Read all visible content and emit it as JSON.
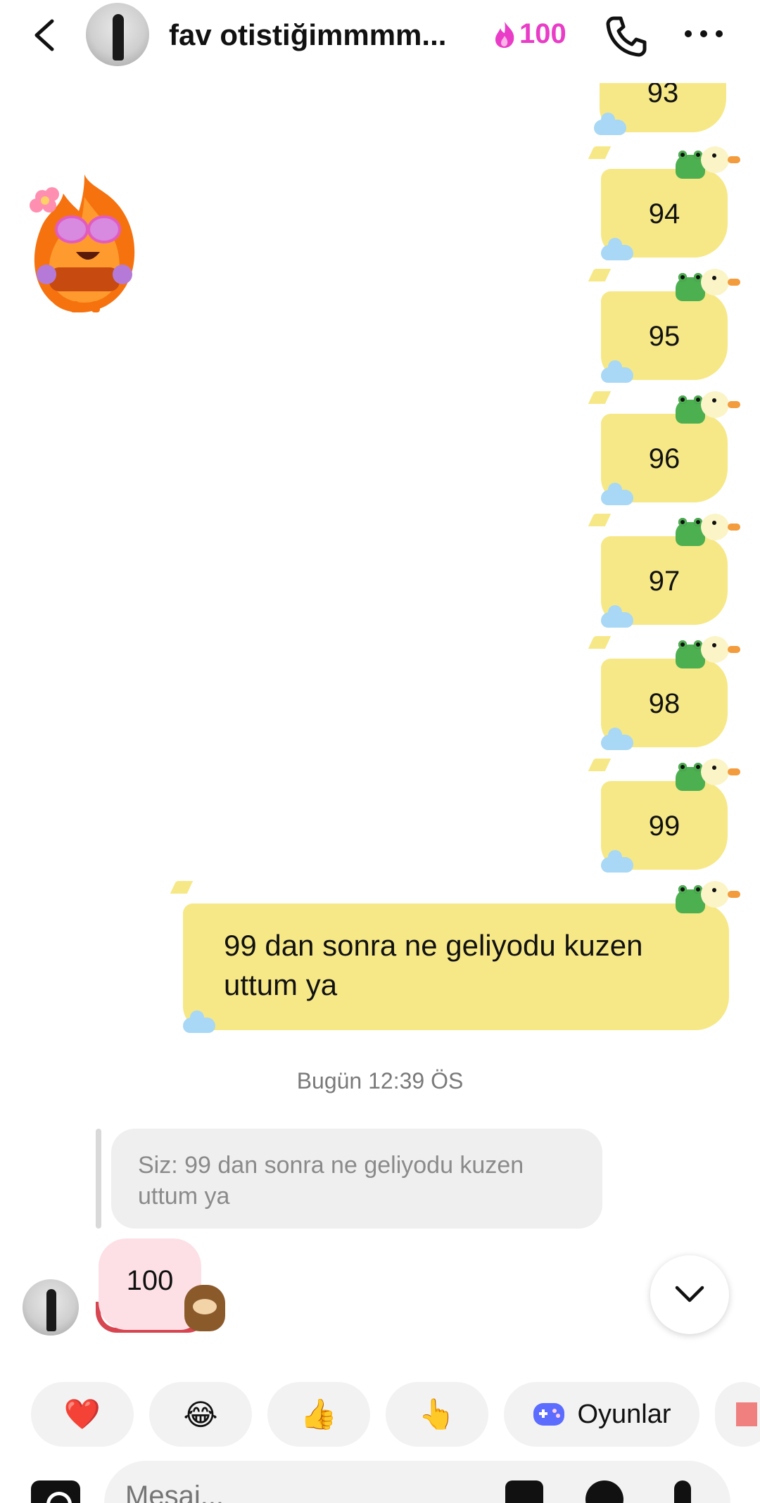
{
  "header": {
    "title": "fav otistiğimmmm...",
    "streak_count": "100",
    "icons": [
      "back-chevron-icon",
      "avatar",
      "fire-icon",
      "phone-icon",
      "more-icon"
    ]
  },
  "messages": {
    "sent_numbers": [
      "93",
      "94",
      "95",
      "96",
      "97",
      "98",
      "99"
    ],
    "sent_text": "99 dan sonra ne geliyodu kuzen uttum ya",
    "timestamp": "Bugün 12:39 ÖS",
    "reply_quote": "Siz: 99 dan sonra ne geliyodu kuzen uttum ya",
    "received_text": "100"
  },
  "quick_replies": {
    "emojis": [
      "❤️",
      "😂",
      "👍",
      "👆"
    ],
    "games_label": "Oyunlar"
  },
  "composer": {
    "placeholder": "Mesaj..."
  },
  "colors": {
    "accent_pink": "#e93cc7",
    "duck_yellow": "#f6e887",
    "received_pink": "#fde0e6"
  }
}
